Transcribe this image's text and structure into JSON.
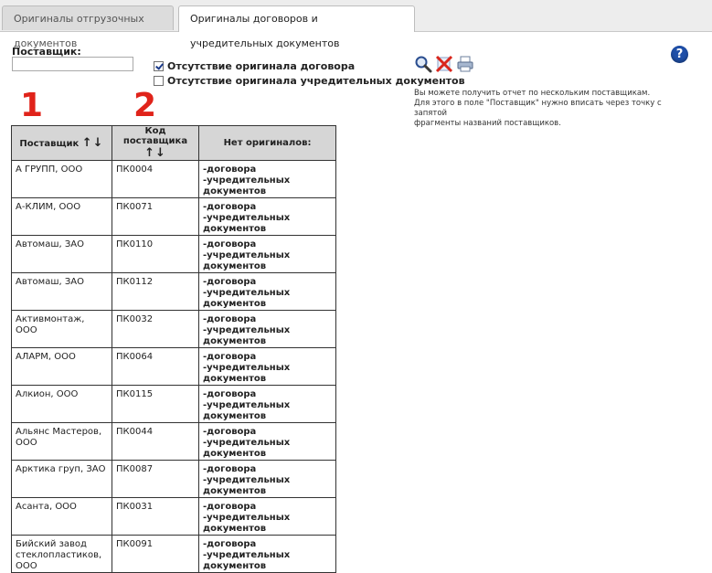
{
  "tabs": [
    {
      "label": "Оригиналы отгрузочных документов",
      "active": false
    },
    {
      "label": "Оригиналы договоров и учредительных документов",
      "active": true
    }
  ],
  "filter": {
    "supplier_label": "Поставщик:",
    "supplier_value": "",
    "checkboxes": [
      {
        "label": "Отсутствие оригинала договора",
        "checked": true
      },
      {
        "label": "Отсутствие оригинала учредительных документов",
        "checked": false
      }
    ]
  },
  "toolbar": {
    "icons": [
      "search-icon",
      "clear-icon",
      "print-icon"
    ]
  },
  "help_label": "?",
  "note": [
    "Вы можете получить отчет по нескольким поставщикам.",
    "Для этого в поле \"Поставщик\" нужно вписать через точку с запятой",
    "фрагменты названий поставщиков."
  ],
  "markers": [
    "1",
    "2"
  ],
  "table": {
    "headers": {
      "supplier": "Поставщик",
      "code": "Код поставщика",
      "missing": "Нет оригиналов:",
      "sort_arrows": "↑↓"
    },
    "rows": [
      {
        "supplier": "А ГРУПП, ООО",
        "code": "ПК0004",
        "missing": [
          "-договора",
          "-учредительных документов"
        ]
      },
      {
        "supplier": "А-КЛИМ, ООО",
        "code": "ПК0071",
        "missing": [
          "-договора",
          "-учредительных документов"
        ]
      },
      {
        "supplier": "Автомаш, ЗАО",
        "code": "ПК0110",
        "missing": [
          "-договора",
          "-учредительных документов"
        ]
      },
      {
        "supplier": "Автомаш, ЗАО",
        "code": "ПК0112",
        "missing": [
          "-договора",
          "-учредительных документов"
        ]
      },
      {
        "supplier": "Активмонтаж, ООО",
        "code": "ПК0032",
        "missing": [
          "-договора",
          "-учредительных документов"
        ]
      },
      {
        "supplier": "АЛАРМ, ООО",
        "code": "ПК0064",
        "missing": [
          "-договора",
          "-учредительных документов"
        ]
      },
      {
        "supplier": "Алкион, ООО",
        "code": "ПК0115",
        "missing": [
          "-договора",
          "-учредительных документов"
        ]
      },
      {
        "supplier": "Альянс Мастеров, ООО",
        "code": "ПК0044",
        "missing": [
          "-договора",
          "-учредительных документов"
        ]
      },
      {
        "supplier": "Арктика груп, ЗАО",
        "code": "ПК0087",
        "missing": [
          "-договора",
          "-учредительных документов"
        ]
      },
      {
        "supplier": "Асанта, ООО",
        "code": "ПК0031",
        "missing": [
          "-договора",
          "-учредительных документов"
        ]
      },
      {
        "supplier": "Бийский завод стеклопластиков, ООО",
        "code": "ПК0091",
        "missing": [
          "-договора",
          "-учредительных документов"
        ]
      }
    ]
  }
}
